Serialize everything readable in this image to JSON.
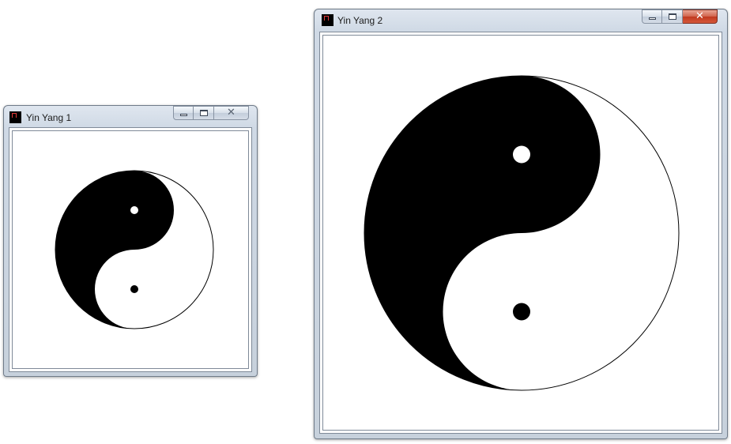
{
  "windows": [
    {
      "title": "Yin Yang 1",
      "active": false,
      "icon": "app-icon",
      "controls": {
        "minimize": "minimize-icon",
        "maximize": "maximize-icon",
        "close": "close-icon",
        "close_glyph": "✕"
      },
      "canvas": {
        "symbol": "yin-yang",
        "colors": {
          "dark": "#000000",
          "light": "#ffffff",
          "outline": "#000000"
        }
      }
    },
    {
      "title": "Yin Yang 2",
      "active": true,
      "icon": "app-icon",
      "controls": {
        "minimize": "minimize-icon",
        "maximize": "maximize-icon",
        "close": "close-icon",
        "close_glyph": "✕"
      },
      "canvas": {
        "symbol": "yin-yang",
        "colors": {
          "dark": "#000000",
          "light": "#ffffff",
          "outline": "#000000"
        }
      }
    }
  ]
}
